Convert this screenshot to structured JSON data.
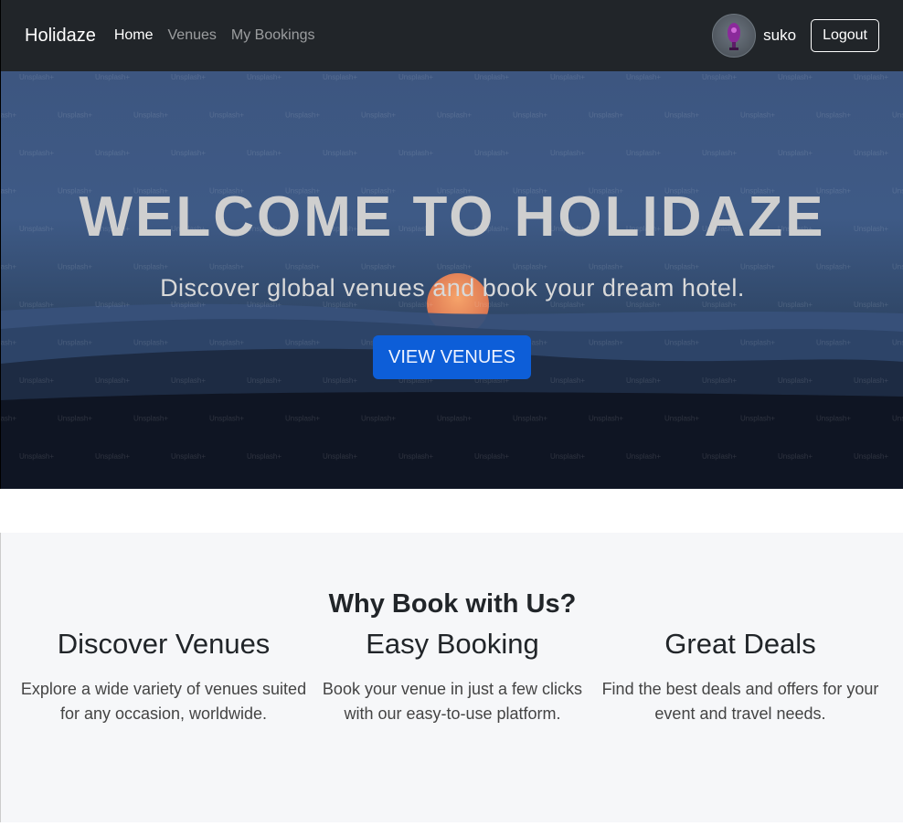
{
  "navbar": {
    "brand": "Holidaze",
    "links": [
      "Home",
      "Venues",
      "My Bookings"
    ],
    "username": "suko",
    "logout_label": "Logout"
  },
  "hero": {
    "title": "WELCOME TO HOLIDAZE",
    "subtitle": "Discover global venues and book your dream hotel.",
    "button_label": "VIEW VENUES",
    "watermark_text": "Unsplash+"
  },
  "features": {
    "heading": "Why Book with Us?",
    "items": [
      {
        "title": "Discover Venues",
        "description": "Explore a wide variety of venues suited for any occasion, worldwide."
      },
      {
        "title": "Easy Booking",
        "description": "Book your venue in just a few clicks with our easy-to-use platform."
      },
      {
        "title": "Great Deals",
        "description": "Find the best deals and offers for your event and travel needs."
      }
    ]
  },
  "colors": {
    "navbar_bg": "#212529",
    "primary_button": "#0d5ed8",
    "features_bg": "#f6f7f9"
  }
}
